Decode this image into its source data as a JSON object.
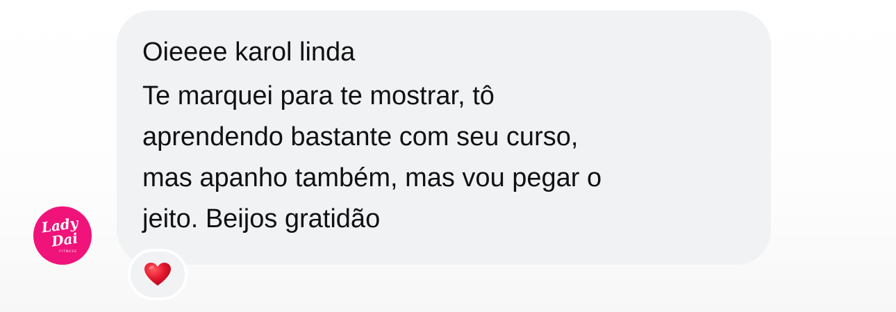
{
  "sender": {
    "avatar_text_line1": "Lady",
    "avatar_text_line2": "Dai",
    "avatar_text_small": "FITNESS",
    "avatar_color": "#f0137a"
  },
  "message": {
    "first_line": "Oieeee karol linda",
    "body": "Te marquei para te mostrar, tô\naprendendo bastante com seu curso,\nmas apanho também,  mas vou pegar o\njeito. Beijos gratidão",
    "bubble_color": "#f1f2f4"
  },
  "reaction": {
    "icon": "red-heart-icon",
    "glyph": "❤",
    "color": "#e3152b"
  }
}
